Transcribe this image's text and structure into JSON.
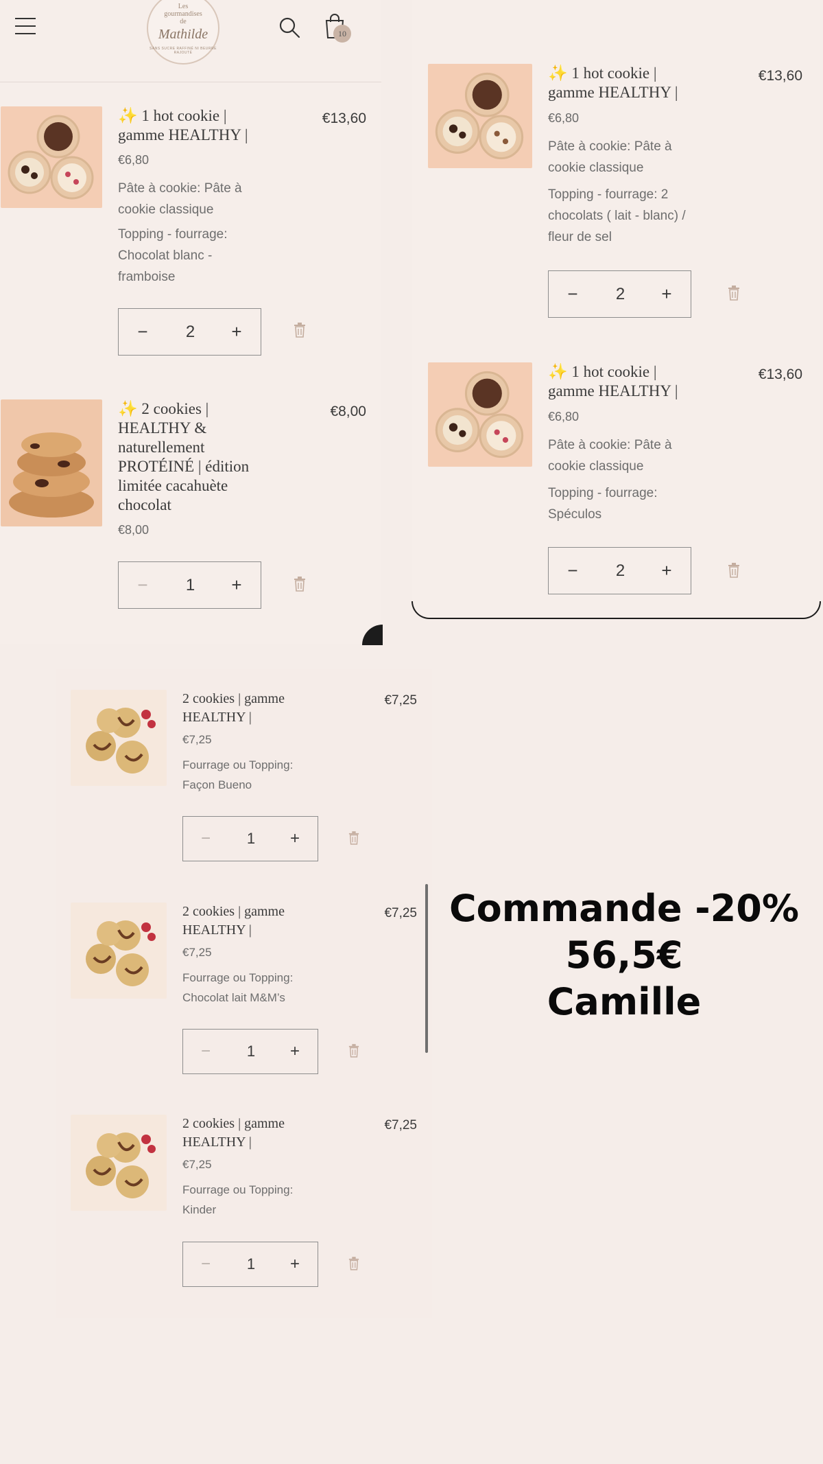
{
  "header": {
    "logo_line1": "Les",
    "logo_line2": "gourmandises",
    "logo_line3": "de",
    "logo_name": "Mathilde",
    "logo_tagline": "SANS SUCRE RAFFINÉ NI BEURRE RAJOUTÉ",
    "cart_count": "10",
    "icons": [
      "menu-icon",
      "search-icon",
      "cart-icon"
    ]
  },
  "items_left": [
    {
      "title": "✨ 1 hot cookie | gamme HEALTHY |",
      "unit_price": "€6,80",
      "options": [
        "Pâte à cookie: Pâte à cookie classique",
        "Topping - fourrage: Chocolat blanc - framboise"
      ],
      "quantity": "2",
      "line_total": "€13,60"
    },
    {
      "title": "✨ 2 cookies | HEALTHY & naturellement PROTÉINÉ | édition limitée cacahuète chocolat",
      "unit_price": "€8,00",
      "options": [],
      "quantity": "1",
      "line_total": "€8,00"
    }
  ],
  "items_right": [
    {
      "title": "✨ 1 hot cookie | gamme HEALTHY |",
      "unit_price": "€6,80",
      "options": [
        "Pâte à cookie: Pâte à cookie classique",
        "Topping - fourrage: 2 chocolats ( lait - blanc) / fleur de sel"
      ],
      "quantity": "2",
      "line_total": "€13,60"
    },
    {
      "title": "✨ 1 hot cookie | gamme HEALTHY |",
      "unit_price": "€6,80",
      "options": [
        "Pâte à cookie: Pâte à cookie classique",
        "Topping - fourrage: Spéculos"
      ],
      "quantity": "2",
      "line_total": "€13,60"
    }
  ],
  "items_bottom": [
    {
      "title": "2 cookies | gamme HEALTHY |",
      "unit_price": "€7,25",
      "options": [
        "Fourrage ou Topping: Façon Bueno"
      ],
      "quantity": "1",
      "line_total": "€7,25"
    },
    {
      "title": "2 cookies | gamme HEALTHY |",
      "unit_price": "€7,25",
      "options": [
        "Fourrage ou Topping: Chocolat lait M&M’s"
      ],
      "quantity": "1",
      "line_total": "€7,25"
    },
    {
      "title": "2 cookies | gamme HEALTHY |",
      "unit_price": "€7,25",
      "options": [
        "Fourrage ou Topping: Kinder"
      ],
      "quantity": "1",
      "line_total": "€7,25"
    }
  ],
  "controls": {
    "minus_symbol": "−",
    "plus_symbol": "+"
  },
  "note": {
    "line1": "Commande -20%",
    "line2": "56,5€",
    "line3": "Camille"
  },
  "colors": {
    "background": "#f5ede9",
    "accent": "#c9b3a5",
    "trash": "#c4ad9f"
  }
}
